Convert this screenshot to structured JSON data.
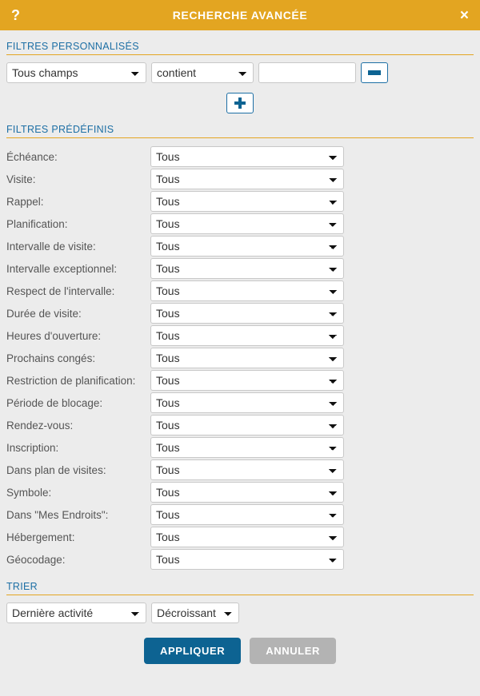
{
  "titlebar": {
    "help_icon": "?",
    "title": "RECHERCHE AVANCÉE",
    "close_icon": "×",
    "background_color": "#e3a521",
    "text_color": "#ffffff"
  },
  "custom_filters": {
    "heading": "FILTRES PERSONNALISÉS",
    "row": {
      "field_value": "Tous champs",
      "operator_value": "contient",
      "text_value": "",
      "text_placeholder": "",
      "remove_label": "−"
    },
    "add_label": "+"
  },
  "predefined_filters": {
    "heading": "FILTRES PRÉDÉFINIS",
    "default_value": "Tous",
    "rows": [
      {
        "label": "Échéance:",
        "value": "Tous"
      },
      {
        "label": "Visite:",
        "value": "Tous"
      },
      {
        "label": "Rappel:",
        "value": "Tous"
      },
      {
        "label": "Planification:",
        "value": "Tous"
      },
      {
        "label": "Intervalle de visite:",
        "value": "Tous"
      },
      {
        "label": "Intervalle exceptionnel:",
        "value": "Tous"
      },
      {
        "label": "Respect de l'intervalle:",
        "value": "Tous"
      },
      {
        "label": "Durée de visite:",
        "value": "Tous"
      },
      {
        "label": "Heures d'ouverture:",
        "value": "Tous"
      },
      {
        "label": "Prochains congés:",
        "value": "Tous"
      },
      {
        "label": "Restriction de planification:",
        "value": "Tous"
      },
      {
        "label": "Période de blocage:",
        "value": "Tous"
      },
      {
        "label": "Rendez-vous:",
        "value": "Tous"
      },
      {
        "label": "Inscription:",
        "value": "Tous"
      },
      {
        "label": "Dans plan de visites:",
        "value": "Tous"
      },
      {
        "label": "Symbole:",
        "value": "Tous"
      },
      {
        "label": "Dans \"Mes Endroits\":",
        "value": "Tous"
      },
      {
        "label": "Hébergement:",
        "value": "Tous"
      },
      {
        "label": "Géocodage:",
        "value": "Tous"
      }
    ]
  },
  "sort": {
    "heading": "TRIER",
    "by_value": "Dernière activité",
    "direction_value": "Décroissant"
  },
  "actions": {
    "apply_label": "APPLIQUER",
    "cancel_label": "ANNULER",
    "apply_color": "#0d6392",
    "cancel_color": "#b3b3b3"
  },
  "theme": {
    "accent_gold": "#e3a521",
    "accent_blue": "#1d6fa5",
    "background": "#ececec"
  }
}
